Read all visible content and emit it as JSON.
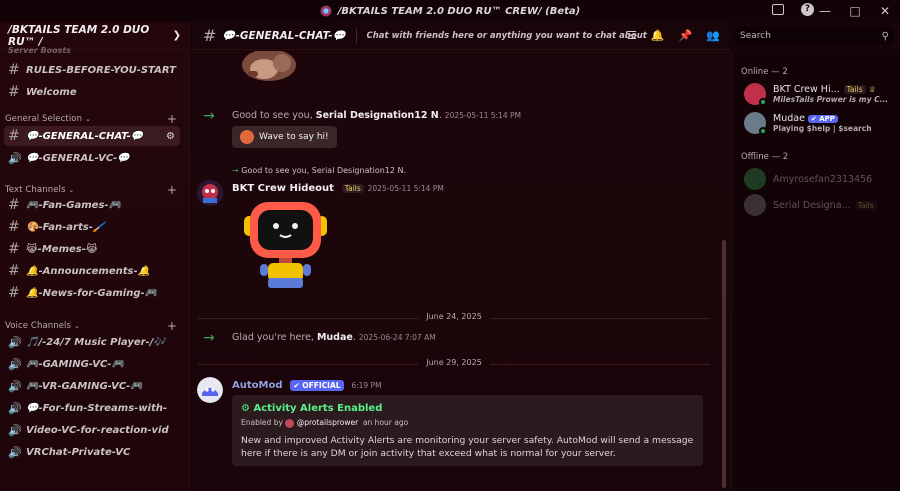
{
  "window": {
    "title": "/BKTAILS TEAM 2.0 DUO RU™ CREW/ (Beta)",
    "controls": [
      "—",
      "□",
      "✕"
    ]
  },
  "server": {
    "name": "/BKTAILS TEAM 2.0 DUO RU™ /"
  },
  "sidebar": {
    "partial_top": "Server Boosts",
    "top_channels": [
      {
        "label": "RULES-BEFORE-YOU-START",
        "icon": "hash"
      },
      {
        "label": "Welcome",
        "icon": "hash"
      }
    ],
    "categories": [
      {
        "name": "General Selection",
        "channels": [
          {
            "label": "💬-GENERAL-CHAT-💬",
            "icon": "hash",
            "active": true
          },
          {
            "label": "💬-GENERAL-VC-💬",
            "icon": "speaker"
          }
        ]
      },
      {
        "name": "Text Channels",
        "channels": [
          {
            "label": "🎮-Fan-Games-🎮",
            "icon": "hash"
          },
          {
            "label": "🎨-Fan-arts-🖌️",
            "icon": "hash"
          },
          {
            "label": "😹-Memes-😹",
            "icon": "hash"
          },
          {
            "label": "🔔-Announcements-🔔",
            "icon": "hash"
          },
          {
            "label": "🔔-News-for-Gaming-🎮",
            "icon": "hash"
          }
        ]
      },
      {
        "name": "Voice Channels",
        "channels": [
          {
            "label": "🎵/-24/7 Music Player-/🎶",
            "icon": "speaker"
          },
          {
            "label": "🎮-GAMING-VC-🎮",
            "icon": "speaker"
          },
          {
            "label": "🎮-VR-GAMING-VC-🎮",
            "icon": "speaker"
          },
          {
            "label": "💬-For-fun-Streams-with-",
            "icon": "speaker"
          },
          {
            "label": "Video-VC-for-reaction-vid",
            "icon": "speaker"
          },
          {
            "label": "VRChat-Private-VC",
            "icon": "speaker"
          }
        ]
      }
    ]
  },
  "channel_header": {
    "name": "💬-GENERAL-CHAT-💬",
    "topic": "Chat with friends here or anything you want to chat about g...",
    "search_placeholder": "Search"
  },
  "messages": {
    "welcome1": {
      "prefix": "Good to see you, ",
      "user": "Serial Designation12 N",
      "suffix": ".",
      "timestamp": "2025-05-11 5:14 PM",
      "wave_label": "Wave to say hi!"
    },
    "reply_line": "Good to see you, Serial Designation12 N.",
    "bkt": {
      "author": "BKT Crew Hideout",
      "tag": "Tails",
      "timestamp": "2025-05-11 5:14 PM"
    },
    "date1": "June 24, 2025",
    "welcome2": {
      "prefix": "Glad you're here, ",
      "user": "Mudae",
      "suffix": ".",
      "timestamp": "2025-06-24 7:07 AM"
    },
    "date2": "June 29, 2025",
    "automod": {
      "author": "AutoMod",
      "badge": "OFFICIAL",
      "timestamp": "6:19 PM",
      "embed_title": "Activity Alerts Enabled",
      "embed_enabled_by": "Enabled by",
      "embed_user": "@protailsprower",
      "embed_time": "an hour ago",
      "embed_desc": "New and improved Activity Alerts are monitoring your server safety. AutoMod will send a message here if there is any DM or join activity that exceed what is normal for your server."
    }
  },
  "members": {
    "online_header": "Online — 2",
    "offline_header": "Offline — 2",
    "online": [
      {
        "name": "BKT Crew Hi...",
        "tag": "Tails",
        "activity": "MilesTails Prower is my C..."
      },
      {
        "name": "Mudae",
        "tag": "APP",
        "activity": "Playing $help | $search"
      }
    ],
    "offline": [
      {
        "name": "Amyrosefan2313456"
      },
      {
        "name": "Serial Designa...",
        "tag": "Tails"
      }
    ]
  },
  "colors": {
    "accent": "#5865f2",
    "online": "#23a55a",
    "embed_title": "#57f287",
    "background": "#150508"
  }
}
